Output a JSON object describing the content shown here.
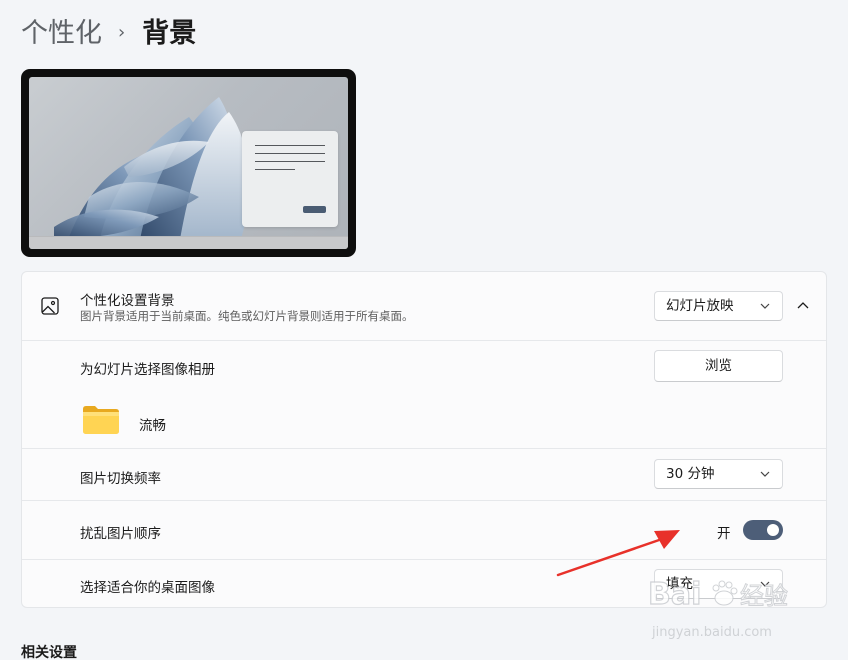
{
  "breadcrumb": {
    "parent": "个性化",
    "separator": "›",
    "current": "背景"
  },
  "preview": {
    "icon": "desktop-preview-image"
  },
  "card": {
    "header": {
      "icon": "image-icon",
      "title": "个性化设置背景",
      "description": "图片背景适用于当前桌面。纯色或幻灯片背景则适用于所有桌面。",
      "dropdown_value": "幻灯片放映",
      "expanded": true
    },
    "album": {
      "label": "为幻灯片选择图像相册",
      "browse_label": "浏览",
      "folder_icon": "folder-icon",
      "folder_name": "流畅"
    },
    "interval": {
      "label": "图片切换频率",
      "value": "30 分钟"
    },
    "shuffle": {
      "label": "扰乱图片顺序",
      "state_text": "开",
      "on": true
    },
    "fit": {
      "label": "选择适合你的桌面图像",
      "value": "填充"
    }
  },
  "related": {
    "title": "相关设置"
  },
  "annotation": {
    "color": "#e8312a"
  },
  "watermark": {
    "brand": "Baidu经验",
    "url": "jingyan.baidu.com"
  },
  "colors": {
    "toggle_on": "#4d5e78",
    "background": "#f3f5f8",
    "card": "#fbfbfc"
  }
}
